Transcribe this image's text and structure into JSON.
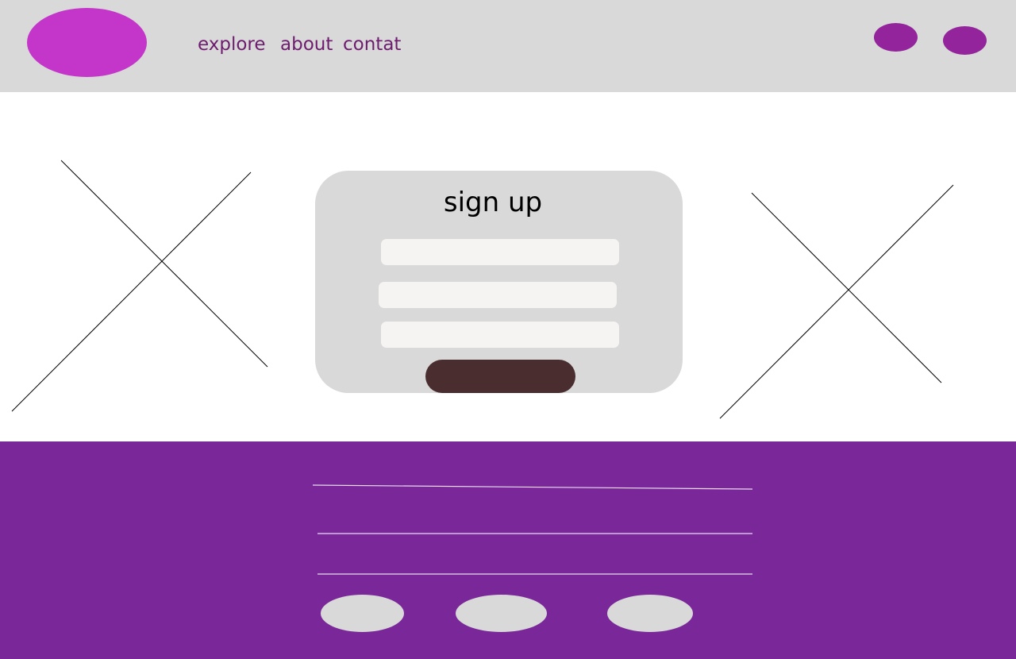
{
  "header": {
    "logo_icon": "logo-ellipse",
    "nav": {
      "explore": "explore",
      "about": "about",
      "contact": "contat"
    },
    "action_icons": [
      "profile-circle-icon",
      "menu-circle-icon"
    ]
  },
  "signup_card": {
    "title": "sign up",
    "fields": [
      "",
      "",
      ""
    ],
    "submit_label": ""
  },
  "footer": {
    "social_icons": [
      "social-circle-icon",
      "social-circle-icon",
      "social-circle-icon"
    ]
  },
  "colors": {
    "header_bg": "#d9d9d9",
    "logo": "#c435c9",
    "nav_text": "#6e1d6e",
    "header_circles": "#93249b",
    "card_bg": "#d9d9d9",
    "field_bg": "#f6f3f3",
    "submit_bg": "#4a2d2f",
    "footer_bg": "#7a2899",
    "footer_circles": "#d9d9d9"
  }
}
